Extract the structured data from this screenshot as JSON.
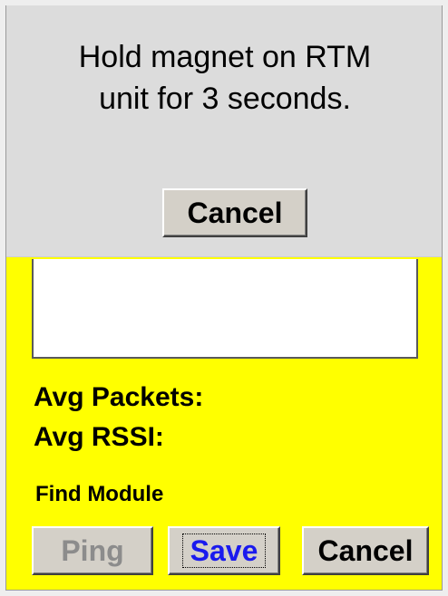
{
  "dialog": {
    "message": "Hold magnet on RTM\nunit for 3 seconds.",
    "cancel_label": "Cancel"
  },
  "stats": {
    "avg_packets_label": "Avg Packets:",
    "avg_rssi_label": "Avg RSSI:"
  },
  "find_module_label": "Find Module",
  "buttons": {
    "ping_label": "Ping",
    "save_label": "Save",
    "cancel_label": "Cancel"
  },
  "colors": {
    "background": "#ffff00",
    "dialog_background": "#dcdcdc",
    "disabled_text": "#8c8c8c",
    "focused_text": "#1a1aee"
  }
}
